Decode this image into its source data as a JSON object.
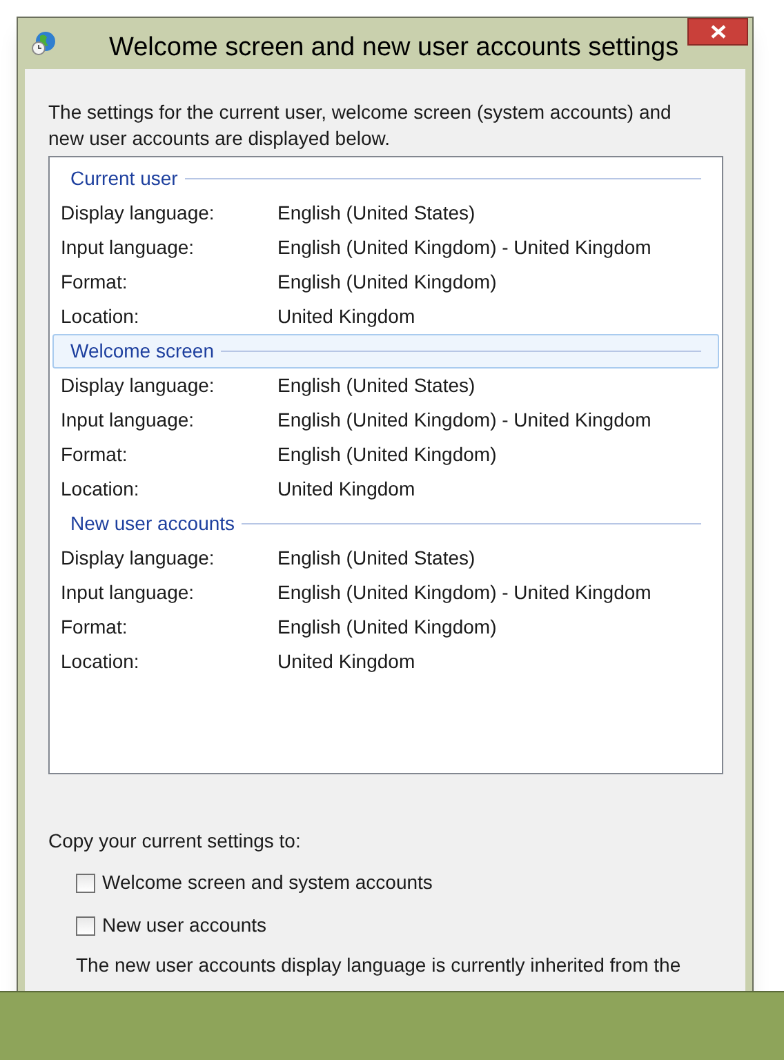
{
  "window": {
    "title": "Welcome screen and new user accounts settings"
  },
  "intro": "The settings for the current user, welcome screen (system accounts) and new user accounts are displayed below.",
  "sections": [
    {
      "title": "Current user",
      "selected": false,
      "rows": [
        {
          "label": "Display language:",
          "value": "English (United States)"
        },
        {
          "label": "Input language:",
          "value": "English (United Kingdom) - United Kingdom"
        },
        {
          "label": "Format:",
          "value": "English (United Kingdom)"
        },
        {
          "label": "Location:",
          "value": "United Kingdom"
        }
      ]
    },
    {
      "title": "Welcome screen",
      "selected": true,
      "rows": [
        {
          "label": "Display language:",
          "value": "English (United States)"
        },
        {
          "label": "Input language:",
          "value": "English (United Kingdom) - United Kingdom"
        },
        {
          "label": "Format:",
          "value": "English (United Kingdom)"
        },
        {
          "label": "Location:",
          "value": "United Kingdom"
        }
      ]
    },
    {
      "title": "New user accounts",
      "selected": false,
      "rows": [
        {
          "label": "Display language:",
          "value": "English (United States)"
        },
        {
          "label": "Input language:",
          "value": "English (United Kingdom) - United Kingdom"
        },
        {
          "label": "Format:",
          "value": "English (United Kingdom)"
        },
        {
          "label": "Location:",
          "value": "United Kingdom"
        }
      ]
    }
  ],
  "copy_label": "Copy your current settings to:",
  "checkboxes": [
    {
      "label": "Welcome screen and system accounts",
      "checked": false
    },
    {
      "label": "New user accounts",
      "checked": false
    }
  ],
  "note": "The new user accounts display language is currently inherited from the"
}
